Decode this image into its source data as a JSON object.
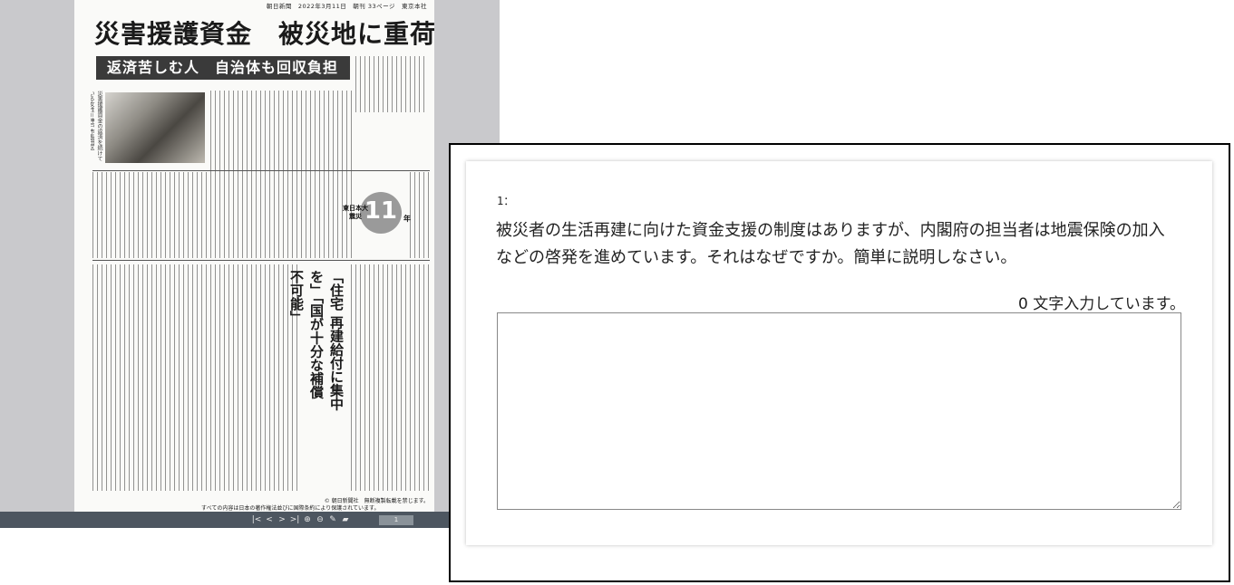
{
  "viewer": {
    "masthead": "朝日新聞　2022年3月11日　朝刊 33ページ　東京本社",
    "headline": "災害援護資金　被災地に重荷",
    "subhead": "返済苦しむ人　自治体も回収負担",
    "photo_caption": "災害援護資金の返済を続けている女性＝神戸市長田区",
    "badge_text": "東日本大震災",
    "badge_number": "11",
    "badge_suffix": "年",
    "vertical_heading": "「住宅 再建給付に集中を」「国が十分な補償 不可能」",
    "footer_line1": "© 朝日新聞社　無断複製転載を禁じます。",
    "footer_line2": "すべての内容は日本の著作権法並びに国際条約により保護されています。",
    "toolbar": {
      "first": "|<",
      "prev": "<",
      "next": ">",
      "last": ">|",
      "zoom_in": "⊕",
      "zoom_out": "⊖",
      "pen": "✎",
      "marker": "▰",
      "page": "1"
    }
  },
  "question": {
    "number": "1：",
    "text": "被災者の生活再建に向けた資金支援の制度はありますが、内閣府の担当者は地震保険の加入などの啓発を進めています。それはなぜですか。簡単に説明しなさい。",
    "counter": "0 文字入力しています。",
    "answer_value": ""
  }
}
